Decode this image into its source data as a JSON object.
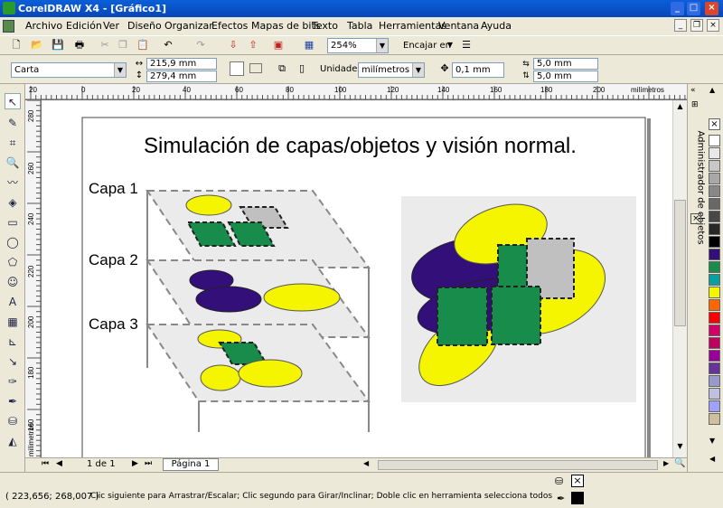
{
  "window": {
    "title": "CorelDRAW X4 - [Gráfico1]"
  },
  "menu": {
    "items": [
      "Archivo",
      "Edición",
      "Ver",
      "Diseño",
      "Organizar",
      "Efectos",
      "Mapas de bits",
      "Texto",
      "Tabla",
      "Herramientas",
      "Ventana",
      "Ayuda"
    ]
  },
  "toolbar": {
    "zoom": "254%",
    "snap": "Encajar en"
  },
  "property_bar": {
    "paper": "Carta",
    "width": "215,9 mm",
    "height": "279,4 mm",
    "units_label": "Unidades:",
    "units": "milímetros",
    "nudge": "0,1 mm",
    "dup_x": "5,0 mm",
    "dup_y": "5,0 mm"
  },
  "ruler": {
    "top_ticks": [
      "20",
      "0",
      "20",
      "40",
      "60",
      "80",
      "100",
      "120",
      "140",
      "160",
      "180",
      "200"
    ],
    "top_unit": "milímetros",
    "left_ticks": [
      "280",
      "260",
      "240",
      "220",
      "200",
      "180",
      "160"
    ],
    "left_unit": "milímetros"
  },
  "drawing": {
    "title": "Simulación de capas/objetos y visión normal.",
    "layer1": "Capa 1",
    "layer2": "Capa 2",
    "layer3": "Capa 3"
  },
  "page_nav": {
    "counter": "1 de 1",
    "tab": "Página 1"
  },
  "docker": {
    "title": "Administrador de objetos"
  },
  "status": {
    "coords": "( 223,656; 268,007 )",
    "message": "Clic siguiente para Arrastrar/Escalar; Clic segundo para Girar/Inclinar; Doble clic en herramienta selecciona todos los objetos; M..."
  },
  "colors": {
    "purple": "#330f7a",
    "yellow": "#f5f500",
    "green": "#178c4b",
    "gray": "#c0c0c0",
    "titlebar": "#0a5fd8"
  },
  "palette": [
    "#ffffff",
    "#e8e8e8",
    "#c8c8c8",
    "#a8a8a8",
    "#888888",
    "#686868",
    "#484848",
    "#282828",
    "#000000",
    "#330f7a",
    "#178c4b",
    "#0aa0a0",
    "#f5f500",
    "#ff6600",
    "#ff0000",
    "#d4006a",
    "#c00060",
    "#990099",
    "#663399",
    "#9999cc",
    "#c0c0e0",
    "#a0a0ff",
    "#ccc0a0"
  ]
}
